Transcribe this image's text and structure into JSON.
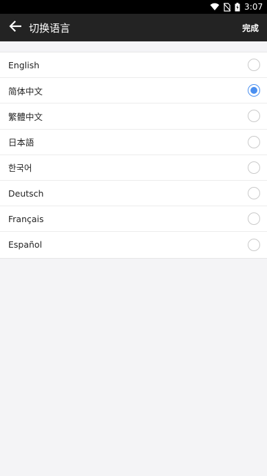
{
  "status_bar": {
    "time": "3:07",
    "icons": [
      "wifi-icon",
      "no-sim-icon",
      "battery-icon"
    ]
  },
  "app_bar": {
    "back_icon": "arrow-left-icon",
    "title": "切换语言",
    "done_label": "完成"
  },
  "languages": [
    {
      "label": "English",
      "selected": false
    },
    {
      "label": "简体中文",
      "selected": true
    },
    {
      "label": "繁體中文",
      "selected": false
    },
    {
      "label": "日本語",
      "selected": false
    },
    {
      "label": "한국어",
      "selected": false
    },
    {
      "label": "Deutsch",
      "selected": false
    },
    {
      "label": "Français",
      "selected": false
    },
    {
      "label": "Español",
      "selected": false
    }
  ],
  "colors": {
    "accent": "#4a8ff0",
    "app_bar": "#232323",
    "background": "#f4f4f6"
  }
}
